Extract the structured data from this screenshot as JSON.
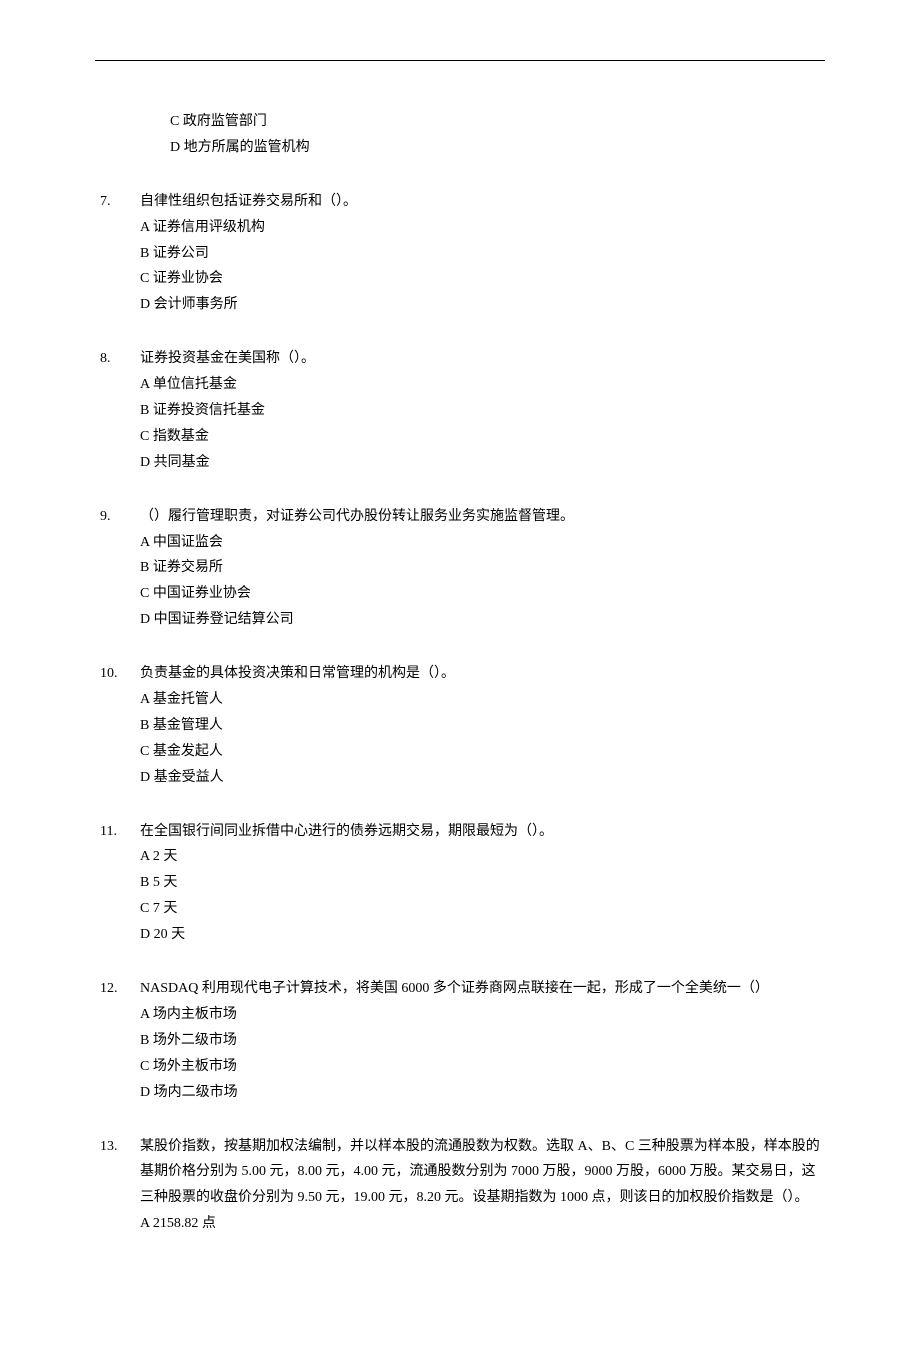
{
  "orphan": {
    "c": "C 政府监管部门",
    "d": "D 地方所属的监管机构"
  },
  "questions": [
    {
      "num": "7.",
      "stem": "自律性组织包括证券交易所和（）。",
      "opts": [
        "A 证券信用评级机构",
        "B 证券公司",
        "C 证券业协会",
        "D 会计师事务所"
      ]
    },
    {
      "num": "8.",
      "stem": "证券投资基金在美国称（）。",
      "opts": [
        "A 单位信托基金",
        "B 证券投资信托基金",
        "C 指数基金",
        "D 共同基金"
      ]
    },
    {
      "num": "9.",
      "stem": "（）履行管理职责，对证券公司代办股份转让服务业务实施监督管理。",
      "opts": [
        "A 中国证监会",
        "B 证券交易所",
        "C 中国证券业协会",
        "D 中国证券登记结算公司"
      ]
    },
    {
      "num": "10.",
      "stem": "负责基金的具体投资决策和日常管理的机构是（）。",
      "opts": [
        "A 基金托管人",
        "B 基金管理人",
        "C 基金发起人",
        "D 基金受益人"
      ]
    },
    {
      "num": "11.",
      "stem": "在全国银行间同业拆借中心进行的债券远期交易，期限最短为（）。",
      "opts": [
        "A 2 天",
        "B 5 天",
        "C 7 天",
        "D 20 天"
      ]
    },
    {
      "num": "12.",
      "stem": "NASDAQ 利用现代电子计算技术，将美国 6000 多个证券商网点联接在一起，形成了一个全美统一（）",
      "opts": [
        "A 场内主板市场",
        "B 场外二级市场",
        "C 场外主板市场",
        "D 场内二级市场"
      ]
    },
    {
      "num": "13.",
      "stem": "某股价指数，按基期加权法编制，并以样本股的流通股数为权数。选取 A、B、C 三种股票为样本股，样本股的基期价格分别为 5.00 元，8.00 元，4.00 元，流通股数分别为 7000 万股，9000 万股，6000 万股。某交易日，这三种股票的收盘价分别为 9.50 元，19.00 元，8.20 元。设基期指数为 1000 点，则该日的加权股价指数是（）。",
      "opts": [
        "A 2158.82 点"
      ]
    }
  ]
}
